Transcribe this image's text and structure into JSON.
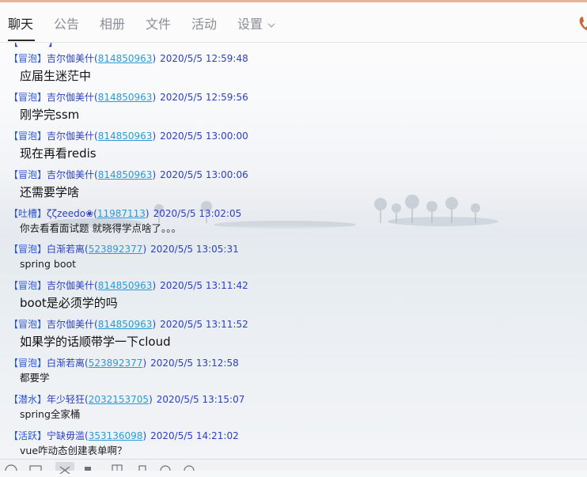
{
  "tabs": [
    {
      "label": "聊天",
      "active": true
    },
    {
      "label": "公告"
    },
    {
      "label": "相册"
    },
    {
      "label": "文件"
    },
    {
      "label": "活动"
    },
    {
      "label": "设置"
    }
  ],
  "messages": [
    {
      "tag": "【冒泡】",
      "name": "吉尔伽美什",
      "uid": "814850963",
      "time": "2020/5/5 12:59:48",
      "text": "应届生迷茫中"
    },
    {
      "tag": "【冒泡】",
      "name": "吉尔伽美什",
      "uid": "814850963",
      "time": "2020/5/5 12:59:56",
      "text": "刚学完ssm"
    },
    {
      "tag": "【冒泡】",
      "name": "吉尔伽美什",
      "uid": "814850963",
      "time": "2020/5/5 13:00:00",
      "text": "现在再看redis"
    },
    {
      "tag": "【冒泡】",
      "name": "吉尔伽美什",
      "uid": "814850963",
      "time": "2020/5/5 13:00:06",
      "text": "还需要学啥"
    },
    {
      "tag": "【吐槽】",
      "name": "ζζzeedo❀",
      "uid": "11987113",
      "time": "2020/5/5 13:02:05",
      "text": "你去看看面试题  就晓得学点啥了。。。"
    },
    {
      "tag": "【冒泡】",
      "name": "白渐若离",
      "uid": "523892377",
      "time": "2020/5/5 13:05:31",
      "text": "spring boot"
    },
    {
      "tag": "【冒泡】",
      "name": "吉尔伽美什",
      "uid": "814850963",
      "time": "2020/5/5 13:11:42",
      "text": "boot是必须学的吗"
    },
    {
      "tag": "【冒泡】",
      "name": "吉尔伽美什",
      "uid": "814850963",
      "time": "2020/5/5 13:11:52",
      "text": "如果学的话顺带学一下cloud"
    },
    {
      "tag": "【冒泡】",
      "name": "白渐若离",
      "uid": "523892377",
      "time": "2020/5/5 13:12:58",
      "text": "都要学"
    },
    {
      "tag": "【潜水】",
      "name": "年少轻狂",
      "uid": "2032153705",
      "time": "2020/5/5 13:15:07",
      "text": "spring全家桶"
    },
    {
      "tag": "【活跃】",
      "name": "宁缺毋滥",
      "uid": "353136098",
      "time": "2020/5/5 14:21:02",
      "text": "vue咋动态创建表单啊？"
    }
  ],
  "toolbar": {
    "icons": [
      "emoji-icon",
      "screenshot-icon",
      "scissors-icon",
      "image-icon",
      "file-icon",
      "voice-icon",
      "history-icon",
      "more-icon"
    ]
  },
  "colors": {
    "accent_line": "#e4b597",
    "meta_blue": "#2c3fc0",
    "uid_link": "#2a9ad6"
  }
}
